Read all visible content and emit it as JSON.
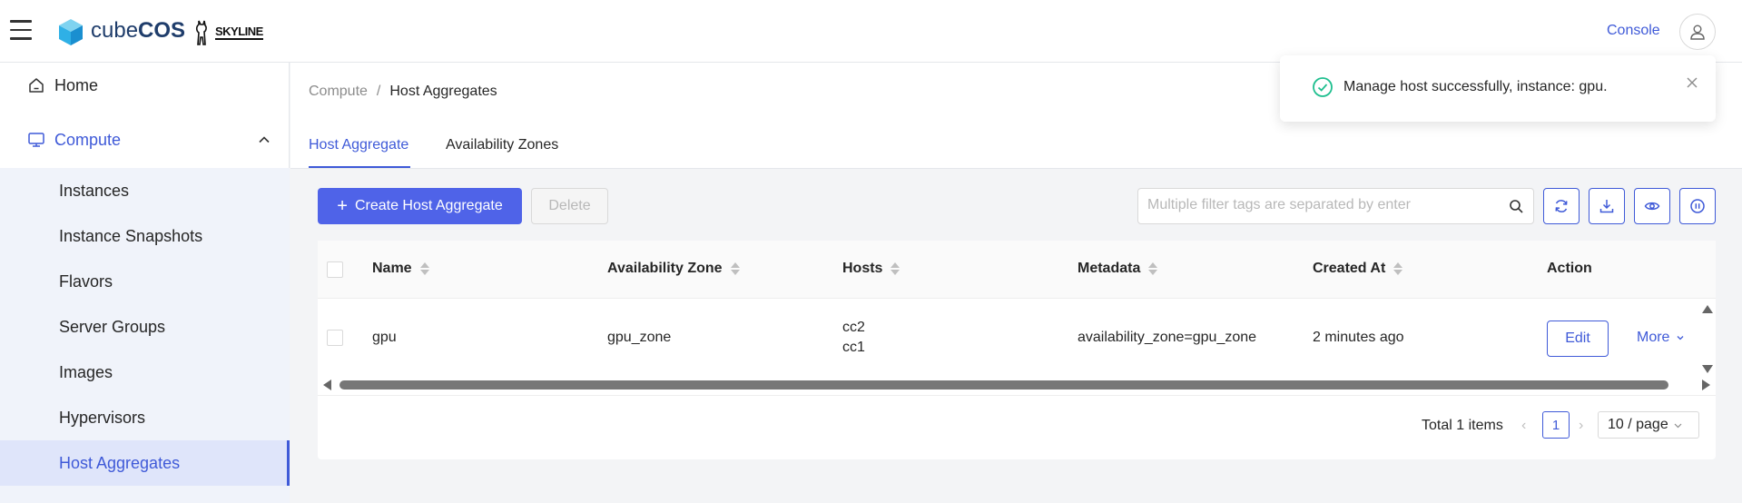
{
  "header": {
    "logo_light": "cube",
    "logo_bold": "COS",
    "partner_logo": "SKYLINE",
    "console_label": "Console",
    "accent_color": "#3f5ad8"
  },
  "sidebar": {
    "home_label": "Home",
    "compute_label": "Compute",
    "items": [
      {
        "label": "Instances"
      },
      {
        "label": "Instance Snapshots"
      },
      {
        "label": "Flavors"
      },
      {
        "label": "Server Groups"
      },
      {
        "label": "Images"
      },
      {
        "label": "Hypervisors"
      },
      {
        "label": "Host Aggregates",
        "active": true
      }
    ]
  },
  "breadcrumb": {
    "parent": "Compute",
    "separator": "/",
    "current": "Host Aggregates"
  },
  "tabs": [
    {
      "label": "Host Aggregate",
      "active": true
    },
    {
      "label": "Availability Zones",
      "active": false
    }
  ],
  "toolbar": {
    "create_label": "Create Host Aggregate",
    "delete_label": "Delete",
    "search_placeholder": "Multiple filter tags are separated by enter",
    "icons": [
      "refresh-icon",
      "download-icon",
      "eye-icon",
      "pause-icon"
    ]
  },
  "table": {
    "columns": [
      "Name",
      "Availability Zone",
      "Hosts",
      "Metadata",
      "Created At",
      "Action"
    ],
    "rows": [
      {
        "name": "gpu",
        "availability_zone": "gpu_zone",
        "hosts": [
          "cc2",
          "cc1"
        ],
        "metadata": "availability_zone=gpu_zone",
        "created_at": "2 minutes ago",
        "edit_label": "Edit",
        "more_label": "More"
      }
    ]
  },
  "pagination": {
    "total_label": "Total 1 items",
    "current_page": "1",
    "page_size": "10 / page"
  },
  "toast": {
    "message": "Manage host successfully, instance: gpu.",
    "status_color": "#1fbf8f"
  }
}
